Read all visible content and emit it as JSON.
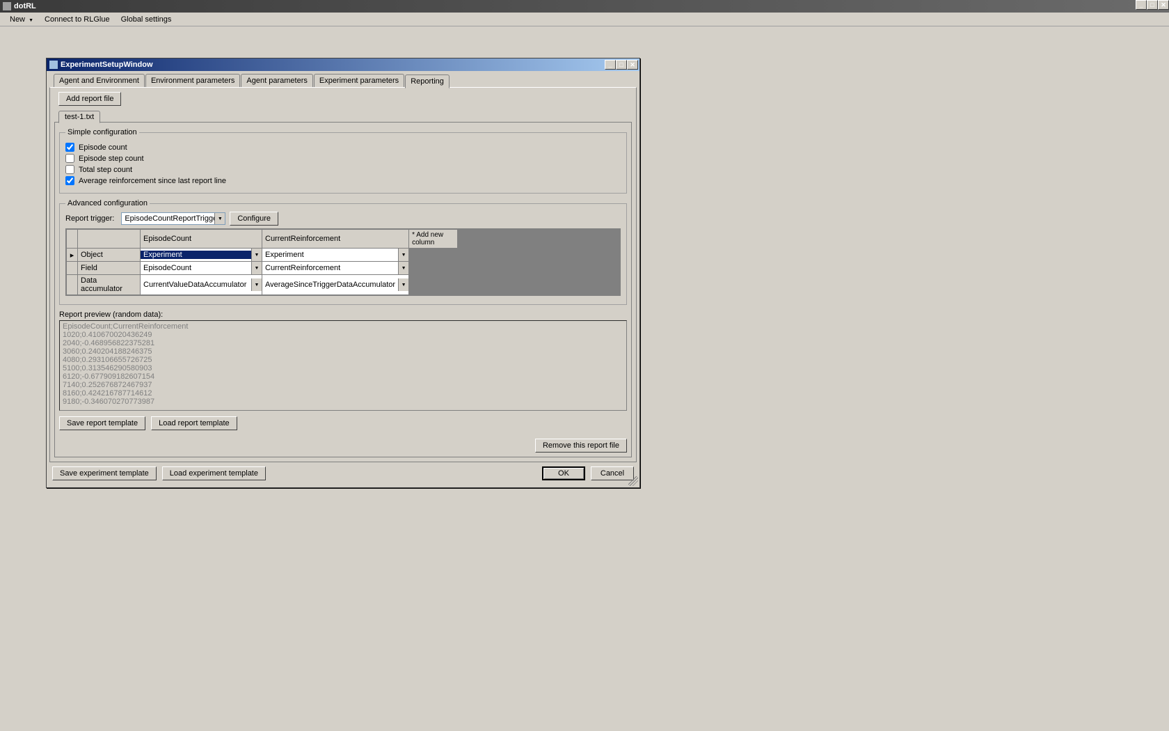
{
  "app": {
    "title": "dotRL"
  },
  "menubar": {
    "items": [
      "New",
      "Connect to RLGlue",
      "Global settings"
    ],
    "new_has_dropdown": true
  },
  "dialog": {
    "title": "ExperimentSetupWindow",
    "tabs": [
      "Agent and Environment",
      "Environment parameters",
      "Agent parameters",
      "Experiment parameters",
      "Reporting"
    ],
    "active_tab": "Reporting",
    "reporting": {
      "add_report_file": "Add report file",
      "current_file": "test-1.txt",
      "simple": {
        "legend": "Simple configuration",
        "checks": [
          {
            "label": "Episode count",
            "checked": true
          },
          {
            "label": "Episode step count",
            "checked": false
          },
          {
            "label": "Total step count",
            "checked": false
          },
          {
            "label": "Average reinforcement since last report line",
            "checked": true
          }
        ]
      },
      "advanced": {
        "legend": "Advanced configuration",
        "trigger_label": "Report trigger:",
        "trigger_value": "EpisodeCountReportTrigger",
        "configure": "Configure"
      },
      "grid": {
        "cols": [
          "",
          "EpisodeCount",
          "CurrentReinforcement"
        ],
        "addcol": "* Add new column",
        "rows": [
          {
            "hdr": "Object",
            "c1": "Experiment",
            "c2": "Experiment",
            "c1_selected": true
          },
          {
            "hdr": "Field",
            "c1": "EpisodeCount",
            "c2": "CurrentReinforcement"
          },
          {
            "hdr": "Data accumulator",
            "c1": "CurrentValueDataAccumulator",
            "c2": "AverageSinceTriggerDataAccumulator"
          }
        ]
      },
      "preview_label": "Report preview (random data):",
      "preview_text": "EpisodeCount;CurrentReinforcement\n1020;0.410670020436249\n2040;-0.468956822375281\n3060;0.240204188246375\n4080;0.293106655726725\n5100;0.313546290580903\n6120;-0.677909182607154\n7140;0.252676872467937\n8160;0.424216787714612\n9180;-0.346070270773987",
      "save_template": "Save report template",
      "load_template": "Load report template",
      "remove_file": "Remove this report file"
    },
    "bottom": {
      "save_exp": "Save experiment template",
      "load_exp": "Load experiment template",
      "ok": "OK",
      "cancel": "Cancel"
    }
  }
}
